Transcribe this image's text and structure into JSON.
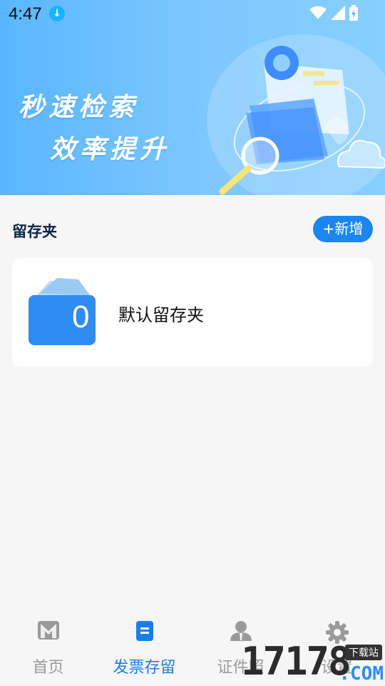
{
  "status_bar": {
    "time": "4:47"
  },
  "banner": {
    "line1": "秒速检索",
    "line2": "效率提升",
    "colors": {
      "start": "#59b6ff",
      "end": "#86cfff"
    }
  },
  "section": {
    "title": "留存夹",
    "add_label": "+新增"
  },
  "folders": [
    {
      "count": "0",
      "name": "默认留存夹"
    }
  ],
  "tabbar": {
    "items": [
      {
        "label": "首页",
        "icon": "home-icon",
        "active": false
      },
      {
        "label": "发票存留",
        "icon": "invoice-icon",
        "active": true
      },
      {
        "label": "证件照",
        "icon": "person-icon",
        "active": false
      },
      {
        "label": "设置",
        "icon": "gear-icon",
        "active": false
      }
    ],
    "accent": "#1a7ee8"
  },
  "watermark": {
    "digits": "17178",
    "suffix": ".COM",
    "site": "下载站"
  }
}
